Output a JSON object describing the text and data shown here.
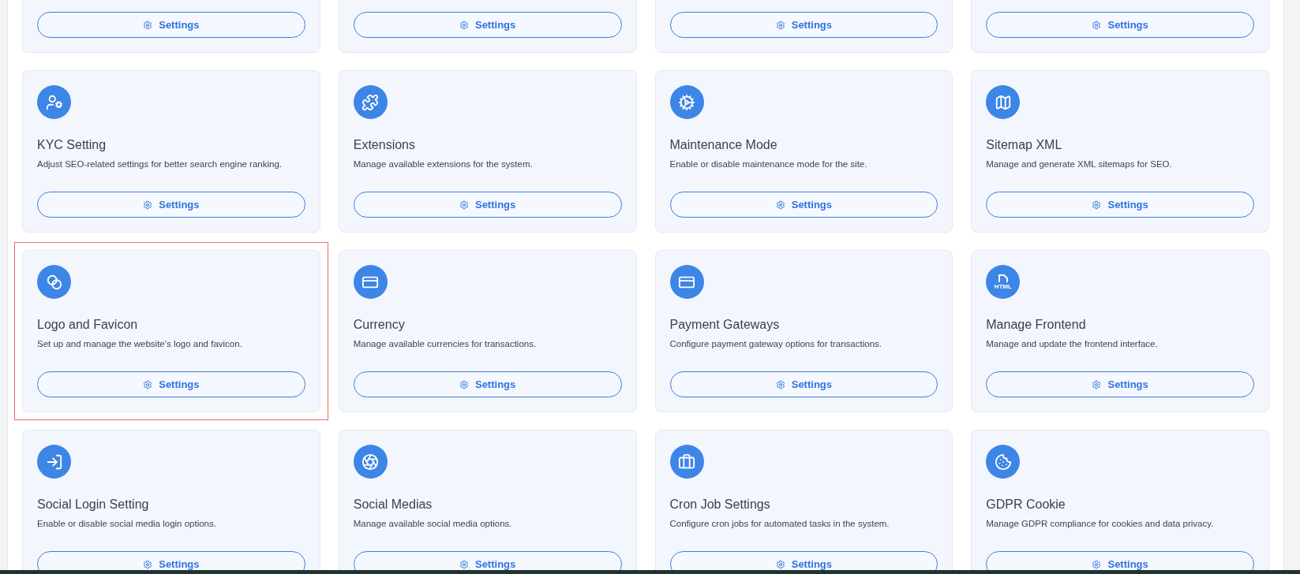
{
  "cards": [
    {
      "button": "Settings",
      "highlighted": false
    },
    {
      "button": "Settings",
      "highlighted": false
    },
    {
      "button": "Settings",
      "highlighted": false
    },
    {
      "button": "Settings",
      "highlighted": false
    },
    {
      "title": "KYC Setting",
      "description": "Adjust SEO-related settings for better search engine ranking.",
      "button": "Settings",
      "highlighted": false
    },
    {
      "title": "Extensions",
      "description": "Manage available extensions for the system.",
      "button": "Settings",
      "highlighted": false
    },
    {
      "title": "Maintenance Mode",
      "description": "Enable or disable maintenance mode for the site.",
      "button": "Settings",
      "highlighted": false
    },
    {
      "title": "Sitemap XML",
      "description": "Manage and generate XML sitemaps for SEO.",
      "button": "Settings",
      "highlighted": false
    },
    {
      "title": "Logo and Favicon",
      "description": "Set up and manage the website's logo and favicon.",
      "button": "Settings",
      "highlighted": true
    },
    {
      "title": "Currency",
      "description": "Manage available currencies for transactions.",
      "button": "Settings",
      "highlighted": false
    },
    {
      "title": "Payment Gateways",
      "description": "Configure payment gateway options for transactions.",
      "button": "Settings",
      "highlighted": false
    },
    {
      "title": "Manage Frontend",
      "icon_text": "HTML",
      "description": "Manage and update the frontend interface.",
      "button": "Settings",
      "highlighted": false
    },
    {
      "title": "Social Login Setting",
      "description": "Enable or disable social media login options.",
      "button": "Settings",
      "highlighted": false
    },
    {
      "title": "Social Medias",
      "description": "Manage available social media options.",
      "button": "Settings",
      "highlighted": false
    },
    {
      "title": "Cron Job Settings",
      "description": "Configure cron jobs for automated tasks in the system.",
      "button": "Settings",
      "highlighted": false
    },
    {
      "title": "GDPR Cookie",
      "description": "Manage GDPR compliance for cookies and data privacy.",
      "button": "Settings",
      "highlighted": false
    }
  ]
}
